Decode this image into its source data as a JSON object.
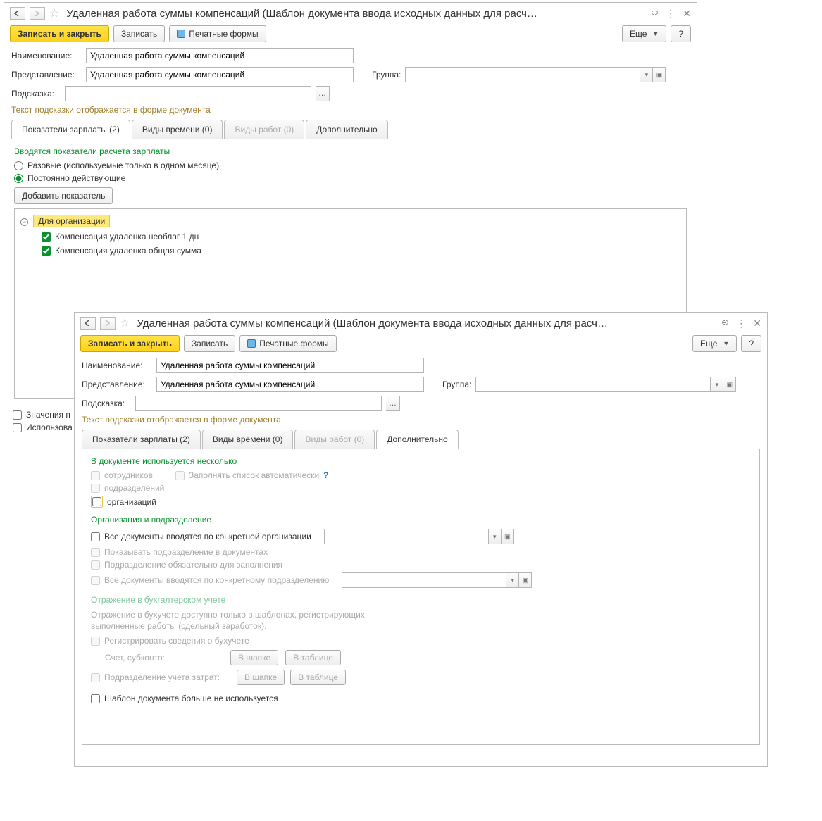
{
  "w1": {
    "title": "Удаленная работа суммы компенсаций (Шаблон документа ввода исходных данных для расч…",
    "toolbar": {
      "save_close": "Записать и закрыть",
      "save": "Записать",
      "print": "Печатные формы",
      "more": "Еще",
      "help": "?"
    },
    "labels": {
      "name": "Наименование:",
      "repr": "Представление:",
      "group": "Группа:",
      "hint": "Подсказка:",
      "hint_note": "Текст подсказки отображается в форме документа"
    },
    "values": {
      "name": "Удаленная работа суммы компенсаций",
      "repr": "Удаленная работа суммы компенсаций"
    },
    "tabs": {
      "salary": "Показатели зарплаты (2)",
      "time": "Виды времени (0)",
      "work": "Виды работ (0)",
      "extra": "Дополнительно"
    },
    "salary": {
      "title": "Вводятся показатели расчета зарплаты",
      "radio_once": "Разовые (используемые только в одном месяце)",
      "radio_perm": "Постоянно действующие",
      "add_btn": "Добавить показатель",
      "group_label": "Для организации",
      "item1": "Компенсация удаленка необлаг 1 дн",
      "item2": "Компенсация удаленка общая сумма"
    },
    "bottom": {
      "chk1": "Значения п",
      "chk2": "Использова"
    }
  },
  "w2": {
    "title": "Удаленная работа суммы компенсаций (Шаблон документа ввода исходных данных для расч…",
    "toolbar": {
      "save_close": "Записать и закрыть",
      "save": "Записать",
      "print": "Печатные формы",
      "more": "Еще",
      "help": "?"
    },
    "labels": {
      "name": "Наименование:",
      "repr": "Представление:",
      "group": "Группа:",
      "hint": "Подсказка:",
      "hint_note": "Текст подсказки отображается в форме документа"
    },
    "values": {
      "name": "Удаленная работа суммы компенсаций",
      "repr": "Удаленная работа суммы компенсаций"
    },
    "tabs": {
      "salary": "Показатели зарплаты (2)",
      "time": "Виды времени (0)",
      "work": "Виды работ (0)",
      "extra": "Дополнительно"
    },
    "extra": {
      "sec1_title": "В документе используется несколько",
      "chk_employees": "сотрудников",
      "chk_autofill": "Заполнять список автоматически",
      "chk_depts": "подразделений",
      "chk_orgs": "организаций",
      "sec2_title": "Организация и подразделение",
      "chk_all_docs_org": "Все документы вводятся по конкретной организации",
      "chk_show_dept": "Показывать подразделение в документах",
      "chk_dept_req": "Подразделение обязательно для заполнения",
      "chk_all_docs_dept": "Все документы вводятся по конкретному подразделению",
      "sec3_title": "Отражение в бухгалтерском учете",
      "sec3_note": "Отражение в бухучете доступно только в шаблонах, регистрирующих выполненные работы (сдельный заработок).",
      "chk_reg_accounting": "Регистрировать сведения о бухучете",
      "lbl_account": "Счет, субконто:",
      "btn_header": "В шапке",
      "btn_table": "В таблице",
      "chk_dept_acct": "Подразделение учета затрат:",
      "chk_not_used": "Шаблон документа больше не используется"
    }
  }
}
